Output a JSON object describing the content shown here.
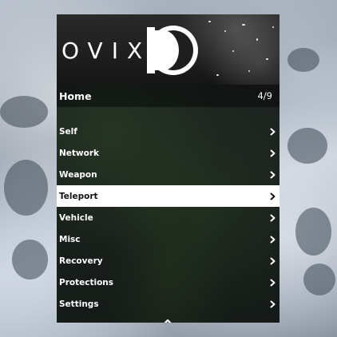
{
  "menu": {
    "logo_text": "OVIX",
    "header_title": "Home",
    "page_indicator": "4/9",
    "selected_index": 3,
    "items": [
      {
        "label": "Self",
        "icon": "chevron-right-icon"
      },
      {
        "label": "Network",
        "icon": "chevron-right-icon"
      },
      {
        "label": "Weapon",
        "icon": "chevron-right-icon"
      },
      {
        "label": "Teleport",
        "icon": "chevron-right-icon"
      },
      {
        "label": "Vehicle",
        "icon": "chevron-right-icon"
      },
      {
        "label": "Misc",
        "icon": "chevron-right-icon"
      },
      {
        "label": "Recovery",
        "icon": "chevron-right-icon"
      },
      {
        "label": "Protections",
        "icon": "chevron-right-icon"
      },
      {
        "label": "Settings",
        "icon": "chevron-right-icon"
      }
    ],
    "scroll_icon": "up-down-arrows-icon"
  },
  "colors": {
    "panel": "#0a0e0c",
    "text": "#ffffff",
    "selected_bg": "#ffffff",
    "selected_text": "#111111"
  }
}
